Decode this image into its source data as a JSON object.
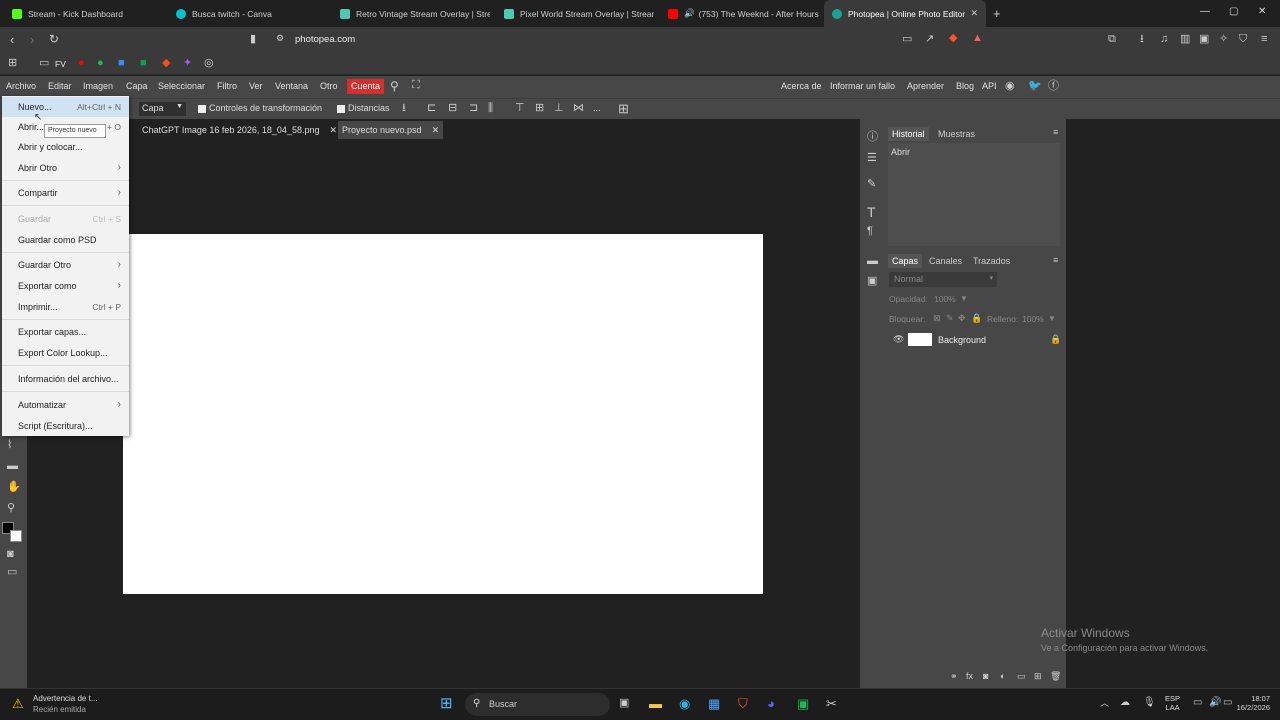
{
  "browser": {
    "tabs": [
      {
        "label": "Stream - Kick Dashboard",
        "color": "#53fc18"
      },
      {
        "label": "Busca twitch - Canva",
        "color": "#00c4cc"
      },
      {
        "label": "Retro Vintage Stream Overlay | Stream",
        "color": "#4cc9b0"
      },
      {
        "label": "Pixel World Stream Overlay | Streame",
        "color": "#4cc9b0"
      },
      {
        "label": "(753) The Weeknd - After Hours (",
        "color": "#ff0000"
      },
      {
        "label": "Photopea | Online Photo Editor",
        "color": "#18a497"
      }
    ],
    "new_tab": "+",
    "url": "photopea.com",
    "bookmarks": {
      "folder": "FV"
    }
  },
  "menubar": {
    "items": [
      "Archivo",
      "Editar",
      "Imagen",
      "Capa",
      "Seleccionar",
      "Filtro",
      "Ver",
      "Ventana",
      "Otro"
    ],
    "cuenta": "Cuenta",
    "right_items": [
      "Acerca de",
      "Informar un fallo",
      "Aprender",
      "Blog",
      "API"
    ]
  },
  "options": {
    "layer_select": "Capa",
    "transform_controls": "Controles de transformación",
    "distances": "Distancias",
    "more": "..."
  },
  "doc_tabs": [
    "ChatGPT Image 16 feb 2026, 18_04_58.png",
    "Proyecto nuevo.psd"
  ],
  "file_menu": {
    "items": [
      {
        "label": "Nuevo...",
        "shortcut": "Alt+Ctrl + N"
      },
      {
        "label": "Abrir...",
        "shortcut": "Ctrl + O"
      },
      {
        "label": "Abrir y colocar..."
      },
      {
        "label": "Abrir Otro",
        "arrow": "›"
      },
      {
        "label": "Compartir",
        "arrow": "›"
      },
      {
        "label": "Guardar",
        "shortcut": "Ctrl + S"
      },
      {
        "label": "Guardar como PSD"
      },
      {
        "label": "Guardar Otro",
        "arrow": "›"
      },
      {
        "label": "Exportar como",
        "arrow": "›"
      },
      {
        "label": "Imprimir...",
        "shortcut": "Ctrl + P"
      },
      {
        "label": "Exportar capas..."
      },
      {
        "label": "Export Color Lookup..."
      },
      {
        "label": "Información del archivo..."
      },
      {
        "label": "Automatizar",
        "arrow": "›"
      },
      {
        "label": "Script (Escritura)..."
      }
    ],
    "tooltip": "Proyecto nuevo"
  },
  "history_panel": {
    "tabs": [
      "Historial",
      "Muestras"
    ],
    "entries": [
      "Abrir"
    ]
  },
  "layers_panel": {
    "tabs": [
      "Capas",
      "Canales",
      "Trazados"
    ],
    "blend_mode": "Normal",
    "opacity_label": "Opacidad:",
    "opacity_value": "100%",
    "lock_label": "Bloquear:",
    "fill_label": "Relleno:",
    "fill_value": "100%",
    "layers": [
      {
        "name": "Background"
      }
    ]
  },
  "watermark": {
    "title": "Activar Windows",
    "subtitle": "Ve a Configuración para activar Windows."
  },
  "taskbar": {
    "notification_title": "Advertencia de t...",
    "notification_sub": "Recién emitida",
    "search_placeholder": "Buscar",
    "lang": "ESP",
    "lang2": "LAA",
    "time": "18:07",
    "date": "16/2/2026"
  }
}
